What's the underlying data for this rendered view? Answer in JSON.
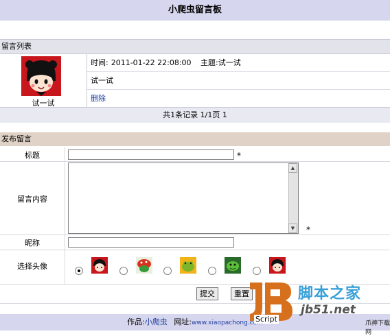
{
  "header": {
    "title": "小爬虫留言板"
  },
  "list": {
    "section_title": "留言列表",
    "message": {
      "author": "试一试",
      "time_label": "时间:",
      "time": "2011-01-22 22:08:00",
      "subject_label": "主题:",
      "subject": "试一试",
      "content": "试一试",
      "delete_label": "删除"
    },
    "pager": "共1条记录 1/1页 1"
  },
  "form": {
    "section_title": "发布留言",
    "title_label": "标题",
    "title_value": "",
    "content_label": "留言内容",
    "content_value": "",
    "nickname_label": "昵称",
    "nickname_value": "",
    "avatar_label": "选择头像",
    "required_mark": "*",
    "avatars": [
      "pucca-avatar",
      "mushroom-avatar",
      "frog-avatar",
      "turtle-avatar",
      "pucca-avatar"
    ],
    "selected_avatar_index": 0,
    "submit_label": "提交",
    "reset_label": "重置"
  },
  "footer": {
    "author_prefix": "作品:",
    "author": "小爬虫",
    "site_prefix": "网址:",
    "site": "www.xiaopachong.com"
  },
  "watermark": {
    "cn": "脚本之家",
    "url": "jb51.net",
    "script": "Script",
    "small": "爪神下载网"
  },
  "colors": {
    "title_bar": "#d6d6ee",
    "section_bar": "#e3e3ec",
    "post_bar": "#e0d2c6",
    "link": "#1f3f9f"
  }
}
